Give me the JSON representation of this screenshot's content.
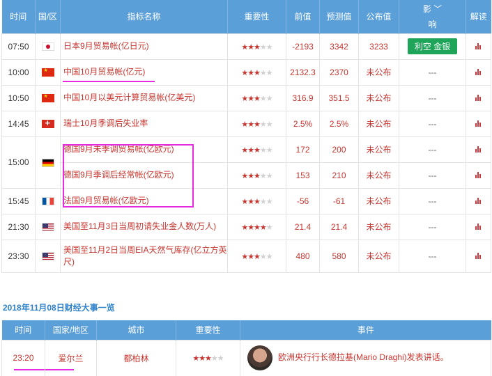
{
  "headers": {
    "time": "时间",
    "country": "国/区",
    "indicator": "指标名称",
    "importance": "重要性",
    "previous": "前值",
    "forecast": "预测值",
    "actual": "公布值",
    "impact_top": "影 ﹀",
    "impact_bottom": "响",
    "explain": "解读"
  },
  "rows": [
    {
      "time": "07:50",
      "flag": "jp-flag-icon",
      "name": "日本9月贸易帐(亿日元)",
      "stars": 3,
      "previous": "-2193",
      "forecast": "3342",
      "actual": "3233",
      "impact": "利空 金银"
    },
    {
      "time": "10:00",
      "flag": "cn-flag-icon",
      "name": "中国10月贸易帐(亿元)",
      "stars": 3,
      "previous": "2132.3",
      "forecast": "2370",
      "actual": "未公布",
      "impact": "---"
    },
    {
      "time": "10:50",
      "flag": "cn-flag-icon",
      "name": "中国10月以美元计算贸易帐(亿美元)",
      "stars": 3,
      "previous": "316.9",
      "forecast": "351.5",
      "actual": "未公布",
      "impact": "---"
    },
    {
      "time": "14:45",
      "flag": "ch-flag-icon",
      "name": "瑞士10月季调后失业率",
      "stars": 3,
      "previous": "2.5%",
      "forecast": "2.5%",
      "actual": "未公布",
      "impact": "---"
    },
    {
      "time": "15:00",
      "flag": "de-flag-icon",
      "name": "德国9月未季调贸易帐(亿欧元)",
      "stars": 3,
      "previous": "172",
      "forecast": "200",
      "actual": "未公布",
      "impact": "---"
    },
    {
      "time": "",
      "flag": "",
      "name": "德国9月季调后经常帐(亿欧元)",
      "stars": 3,
      "previous": "153",
      "forecast": "210",
      "actual": "未公布",
      "impact": "---"
    },
    {
      "time": "15:45",
      "flag": "fr-flag-icon",
      "name": "法国9月贸易帐(亿欧元)",
      "stars": 3,
      "previous": "-56",
      "forecast": "-61",
      "actual": "未公布",
      "impact": "---"
    },
    {
      "time": "21:30",
      "flag": "us-flag-icon",
      "name": "美国至11月3日当周初请失业金人数(万人)",
      "stars": 4,
      "previous": "21.4",
      "forecast": "21.4",
      "actual": "未公布",
      "impact": "---"
    },
    {
      "time": "23:30",
      "flag": "us-flag-icon",
      "name": "美国至11月2日当周EIA天然气库存(亿立方英尺)",
      "stars": 3,
      "previous": "480",
      "forecast": "580",
      "actual": "未公布",
      "impact": "---"
    }
  ],
  "events_section": {
    "title": "2018年11月08日财经大事一览",
    "headers": {
      "time": "时间",
      "country": "国家/地区",
      "city": "城市",
      "importance": "重要性",
      "event": "事件"
    },
    "rows": [
      {
        "time": "23:20",
        "country": "爱尔兰",
        "city": "都柏林",
        "stars": 3,
        "event": "欧洲央行行长德拉基(Mario Draghi)发表讲话。"
      }
    ]
  },
  "colors": {
    "header_bg": "#5b9fd9",
    "accent_red": "#c7352f",
    "badge_green": "#1ea55a",
    "highlight": "#e62ae0"
  }
}
